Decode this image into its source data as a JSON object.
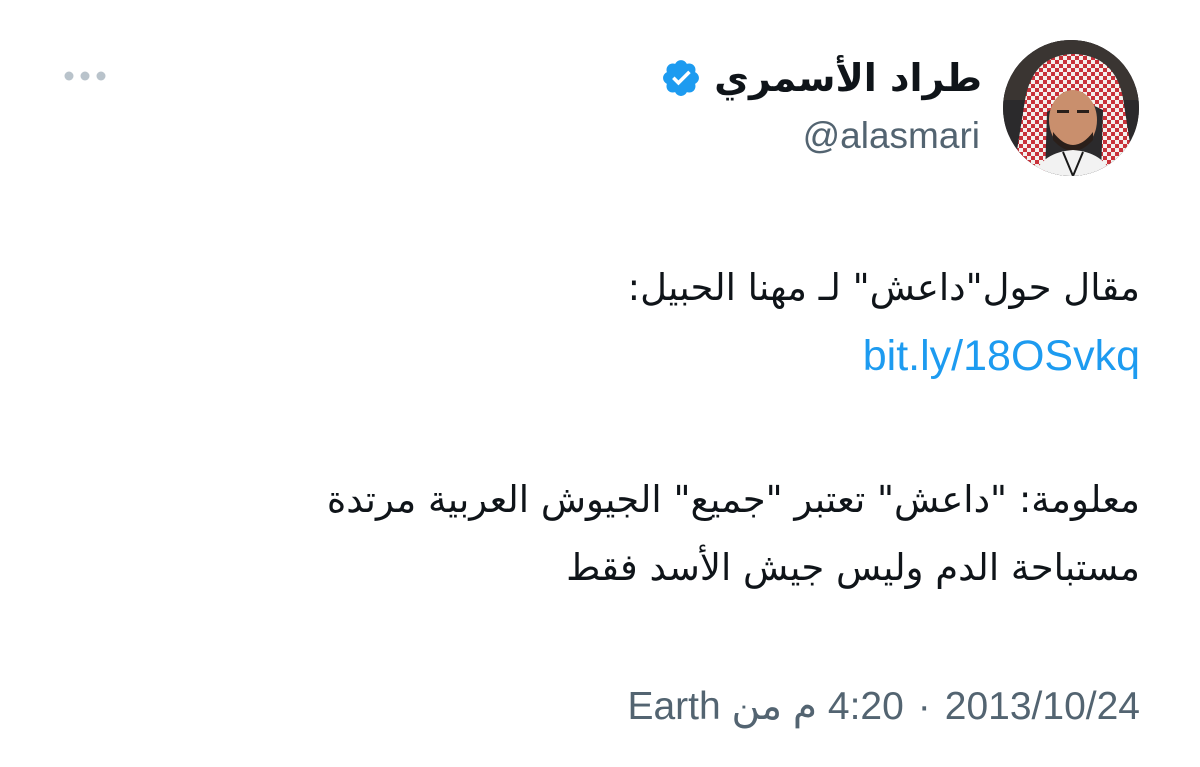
{
  "author": {
    "display_name": "طراد الأسمري",
    "handle": "@alasmari",
    "verified": true
  },
  "icons": {
    "verified": "verified-badge-icon",
    "more": "more-dots-icon",
    "avatar": "profile-photo"
  },
  "tweet": {
    "line1": "مقال حول\"داعش\" لـ مهنا الحبيل:",
    "link": "bit.ly/18OSvkq",
    "line2": "معلومة: \"داعش\" تعتبر \"جميع\" الجيوش العربية مرتدة",
    "line3": "مستباحة الدم وليس جيش الأسد فقط"
  },
  "meta": {
    "date": "2013/10/24",
    "separator": "·",
    "time_from": "4:20 م من Earth"
  },
  "colors": {
    "accent": "#1d9bf0",
    "text": "#0f1419",
    "secondary": "#536471"
  }
}
